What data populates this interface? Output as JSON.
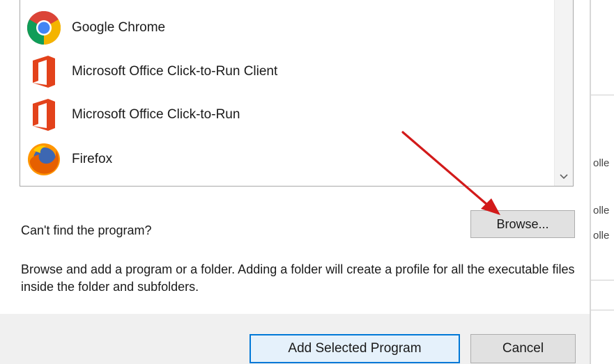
{
  "programs": [
    {
      "label": "Google Chrome",
      "icon": "chrome-icon"
    },
    {
      "label": "Microsoft Office Click-to-Run Client",
      "icon": "office-icon"
    },
    {
      "label": "Microsoft Office Click-to-Run",
      "icon": "office-icon"
    },
    {
      "label": "Firefox",
      "icon": "firefox-icon"
    }
  ],
  "browse": {
    "prompt": "Can't find the program?",
    "button_label": "Browse...",
    "help": "Browse and add a program or a folder. Adding a folder will create a profile for all the executable files inside the folder and subfolders."
  },
  "footer": {
    "add_label": "Add Selected Program",
    "cancel_label": "Cancel"
  },
  "right_panel": {
    "fragments": [
      "olle",
      "olle",
      "olle"
    ]
  },
  "colors": {
    "accent": "#0078d7",
    "arrow": "#d21a1a",
    "office": "#e3421b"
  }
}
